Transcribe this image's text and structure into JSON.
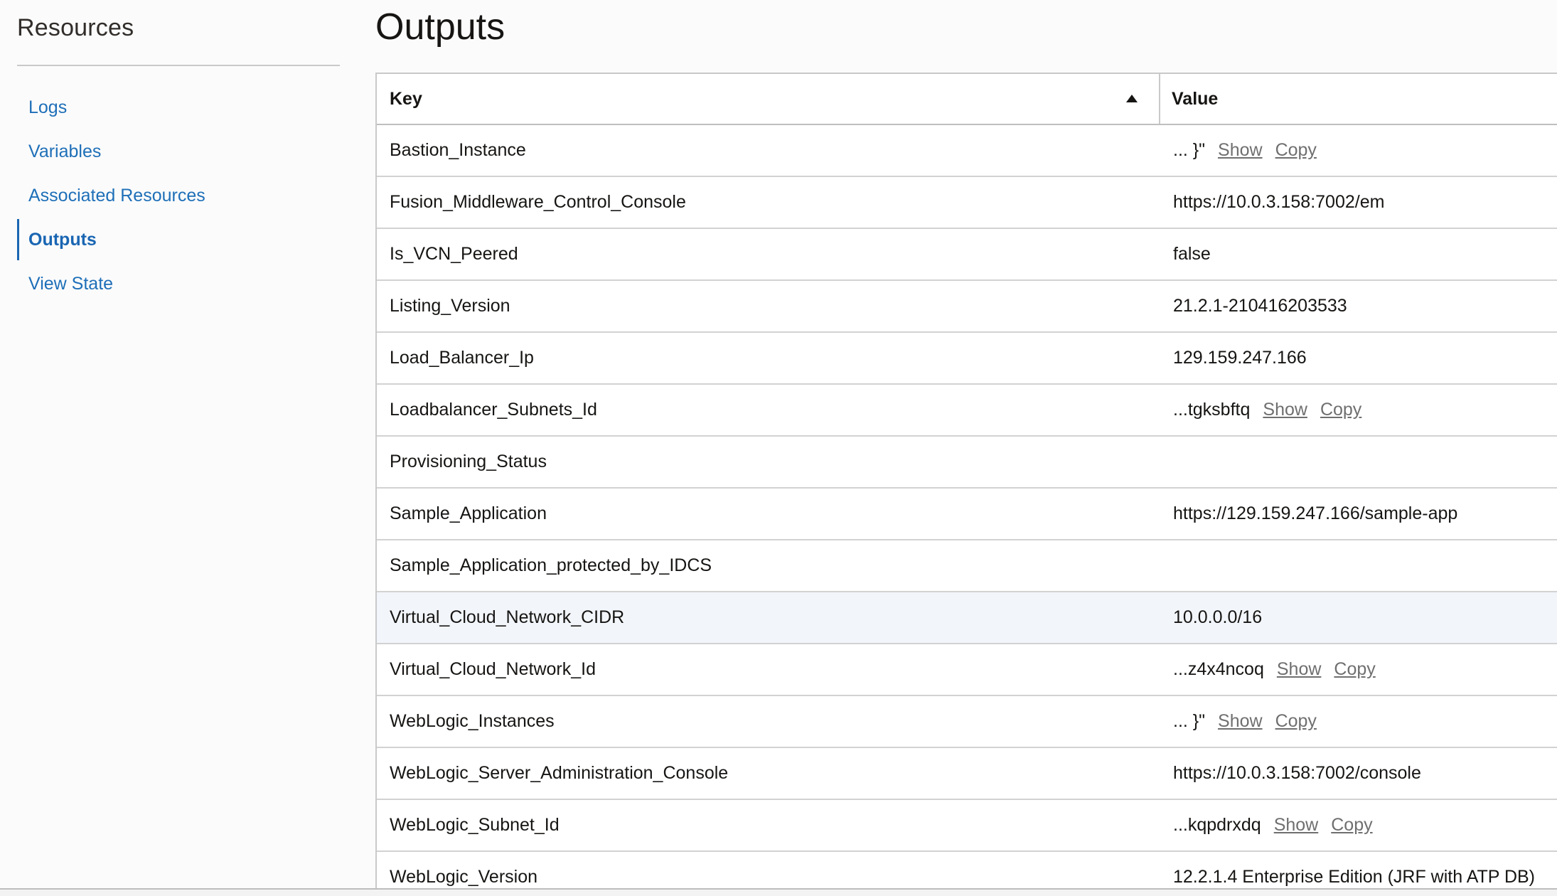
{
  "sidebar": {
    "title": "Resources",
    "items": [
      {
        "label": "Logs",
        "active": false
      },
      {
        "label": "Variables",
        "active": false
      },
      {
        "label": "Associated Resources",
        "active": false
      },
      {
        "label": "Outputs",
        "active": true
      },
      {
        "label": "View State",
        "active": false
      }
    ]
  },
  "main": {
    "title": "Outputs",
    "table": {
      "columns": {
        "key": "Key",
        "value": "Value"
      },
      "sort": {
        "column": "Key",
        "direction": "ascending"
      },
      "show_label": "Show",
      "copy_label": "Copy",
      "rows": [
        {
          "key": "Bastion_Instance",
          "value": "... }\"",
          "actions": true
        },
        {
          "key": "Fusion_Middleware_Control_Console",
          "value": "https://10.0.3.158:7002/em",
          "actions": false
        },
        {
          "key": "Is_VCN_Peered",
          "value": "false",
          "actions": false
        },
        {
          "key": "Listing_Version",
          "value": "21.2.1-210416203533",
          "actions": false
        },
        {
          "key": "Load_Balancer_Ip",
          "value": "129.159.247.166",
          "actions": false
        },
        {
          "key": "Loadbalancer_Subnets_Id",
          "value": "...tgksbftq",
          "actions": true
        },
        {
          "key": "Provisioning_Status",
          "value": "",
          "actions": false
        },
        {
          "key": "Sample_Application",
          "value": "https://129.159.247.166/sample-app",
          "actions": false
        },
        {
          "key": "Sample_Application_protected_by_IDCS",
          "value": "",
          "actions": false
        },
        {
          "key": "Virtual_Cloud_Network_CIDR",
          "value": "10.0.0.0/16",
          "actions": false,
          "highlighted": true
        },
        {
          "key": "Virtual_Cloud_Network_Id",
          "value": "...z4x4ncoq",
          "actions": true
        },
        {
          "key": "WebLogic_Instances",
          "value": "... }\"",
          "actions": true
        },
        {
          "key": "WebLogic_Server_Administration_Console",
          "value": "https://10.0.3.158:7002/console",
          "actions": false
        },
        {
          "key": "WebLogic_Subnet_Id",
          "value": "...kqpdrxdq",
          "actions": true
        },
        {
          "key": "WebLogic_Version",
          "value": "12.2.1.4 Enterprise Edition (JRF with ATP DB)",
          "actions": false
        }
      ]
    }
  },
  "colors": {
    "link": "#1e6fb8",
    "active_nav": "#1a66b3",
    "action_link": "#6f6f6f",
    "highlight_row": "#f2f5fa"
  },
  "icons": {
    "sort": "triangle-up-sort-icon"
  }
}
